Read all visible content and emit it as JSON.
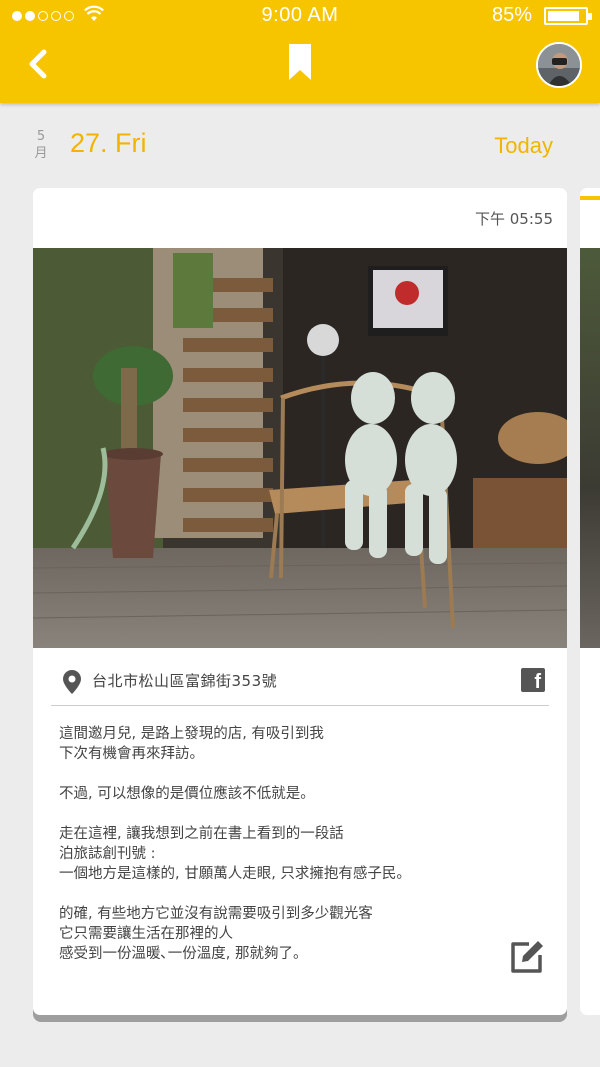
{
  "status": {
    "time": "9:00  AM",
    "battery_percent": "85%",
    "battery_level": 0.85,
    "signal_bars": 2
  },
  "nav": {
    "back_icon": "chevron-left-icon",
    "bookmark_icon": "bookmark-icon",
    "avatar": "user-avatar"
  },
  "date": {
    "month": "5",
    "month_unit": "月",
    "day_label": "27. Fri",
    "today_label": "Today"
  },
  "post": {
    "time": "下午 05:55",
    "address": "台北市松山區富錦街353號",
    "share_icon": "facebook-icon",
    "paragraphs": [
      "這間邀月兒, 是路上發現的店, 有吸引到我\n下次有機會再來拜訪。",
      "不過, 可以想像的是價位應該不低就是。",
      "走在這裡, 讓我想到之前在書上看到的一段話\n泊旅誌創刊號 :\n一個地方是這樣的, 甘願萬人走眼, 只求擁抱有感子民。",
      "的確, 有些地方它並沒有說需要吸引到多少觀光客\n它只需要讓生活在那裡的人\n感受到一份溫暖､一份溫度, 那就夠了。"
    ],
    "edit_icon": "edit-icon"
  },
  "colors": {
    "accent": "#f7c500",
    "date_text": "#f2b400",
    "background": "#ececec"
  }
}
